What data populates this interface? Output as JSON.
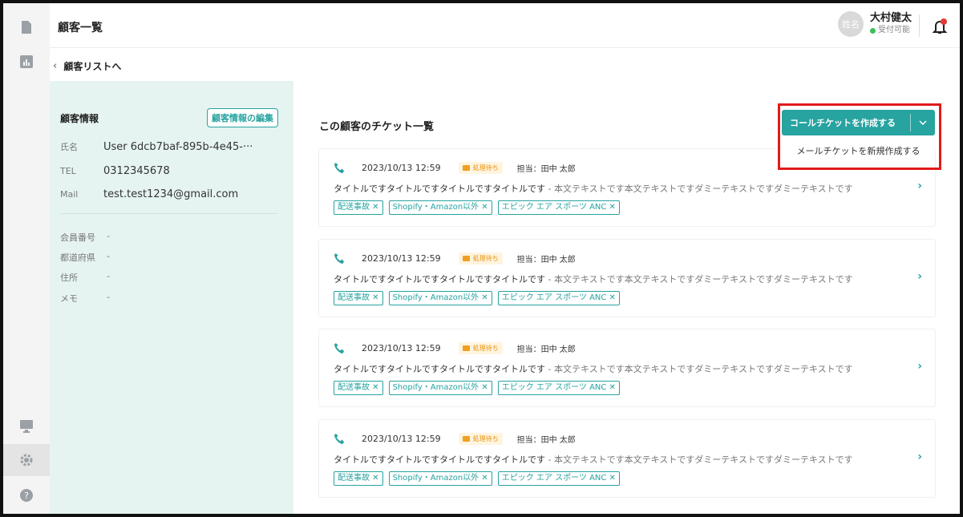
{
  "header": {
    "title": "顧客一覧",
    "user": {
      "avatar_text": "姓名",
      "name": "大村健太",
      "status": "受付可能"
    }
  },
  "back_link": "顧客リストへ",
  "customer": {
    "title": "顧客情報",
    "edit_label": "顧客情報の編集",
    "fields": [
      {
        "label": "氏名",
        "value": "User 6dcb7baf-895b-4e45-···"
      },
      {
        "label": "TEL",
        "value": "0312345678"
      },
      {
        "label": "Mail",
        "value": "test.test1234@gmail.com"
      }
    ],
    "extra_fields": [
      {
        "label": "会員番号",
        "value": "-"
      },
      {
        "label": "都道府県",
        "value": "-"
      },
      {
        "label": "住所",
        "value": "-"
      },
      {
        "label": "メモ",
        "value": "-"
      }
    ]
  },
  "tickets_title": "この顧客のチケット一覧",
  "create": {
    "label": "コールチケットを作成する",
    "dropdown_item": "メールチケットを新規作成する"
  },
  "tickets": [
    {
      "datetime": "2023/10/13 12:59",
      "status": "処理待ち",
      "assignee": "担当：田中 太郎",
      "title": "タイトルですタイトルですタイトルですタイトルです",
      "body": " - 本文テキストです本文テキストですダミーテキストですダミーテキストです",
      "tags": [
        "配送事故 ✕",
        "Shopify・Amazon以外 ✕",
        "エピック エア スポーツ ANC ✕"
      ]
    },
    {
      "datetime": "2023/10/13 12:59",
      "status": "処理待ち",
      "assignee": "担当：田中 太郎",
      "title": "タイトルですタイトルですタイトルですタイトルです",
      "body": " - 本文テキストです本文テキストですダミーテキストですダミーテキストです",
      "tags": [
        "配送事故 ✕",
        "Shopify・Amazon以外 ✕",
        "エピック エア スポーツ ANC ✕"
      ]
    },
    {
      "datetime": "2023/10/13 12:59",
      "status": "処理待ち",
      "assignee": "担当：田中 太郎",
      "title": "タイトルですタイトルですタイトルですタイトルです",
      "body": " - 本文テキストです本文テキストですダミーテキストですダミーテキストです",
      "tags": [
        "配送事故 ✕",
        "Shopify・Amazon以外 ✕",
        "エピック エア スポーツ ANC ✕"
      ]
    },
    {
      "datetime": "2023/10/13 12:59",
      "status": "処理待ち",
      "assignee": "担当：田中 太郎",
      "title": "タイトルですタイトルですタイトルですタイトルです",
      "body": " - 本文テキストです本文テキストですダミーテキストですダミーテキストです",
      "tags": [
        "配送事故 ✕",
        "Shopify・Amazon以外 ✕",
        "エピック エア スポーツ ANC ✕"
      ]
    }
  ],
  "colors": {
    "accent": "#27a3a0",
    "panel": "#e6f4f1",
    "highlight": "#e01b1b",
    "badge": "#e8940a"
  }
}
